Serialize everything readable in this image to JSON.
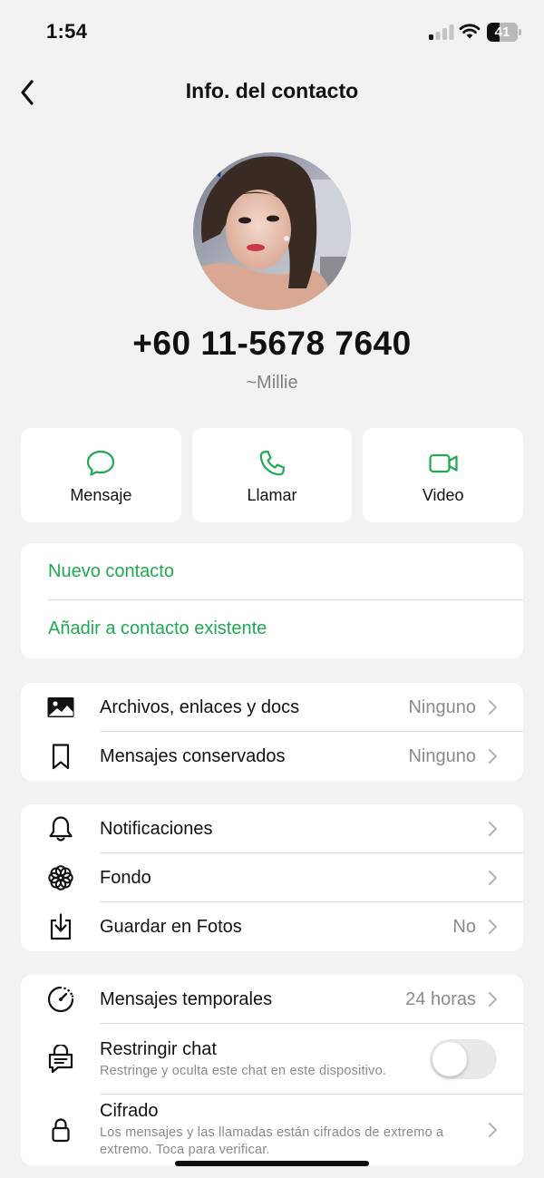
{
  "status": {
    "time": "1:54",
    "battery": "41",
    "battery_level": 0.41
  },
  "nav": {
    "title": "Info. del contacto",
    "back_icon": "chevron-left-icon"
  },
  "contact": {
    "phone": "+60 11-5678 7640",
    "name": "~Millie"
  },
  "actions": [
    {
      "label": "Mensaje",
      "icon": "message-bubble-icon"
    },
    {
      "label": "Llamar",
      "icon": "phone-icon"
    },
    {
      "label": "Video",
      "icon": "video-camera-icon"
    }
  ],
  "add_contact": {
    "new_contact": "Nuevo contacto",
    "add_existing": "Añadir a contacto existente"
  },
  "media": {
    "files": {
      "label": "Archivos, enlaces y docs",
      "value": "Ninguno"
    },
    "starred": {
      "label": "Mensajes conservados",
      "value": "Ninguno"
    }
  },
  "settings": {
    "notifications": {
      "label": "Notificaciones"
    },
    "wallpaper": {
      "label": "Fondo"
    },
    "save_photos": {
      "label": "Guardar en Fotos",
      "value": "No"
    }
  },
  "privacy": {
    "disappearing": {
      "label": "Mensajes temporales",
      "value": "24 horas"
    },
    "restrict": {
      "label": "Restringir chat",
      "sub": "Restringe y oculta este chat en este dispositivo.",
      "enabled": false
    },
    "encryption": {
      "label": "Cifrado",
      "sub": "Los mensajes y las llamadas están cifrados de extremo a extremo. Toca para verificar."
    }
  },
  "colors": {
    "accent_green": "#1ea952",
    "background": "#f2f2f2",
    "card": "#ffffff",
    "secondary_text": "#8a8a8a"
  }
}
